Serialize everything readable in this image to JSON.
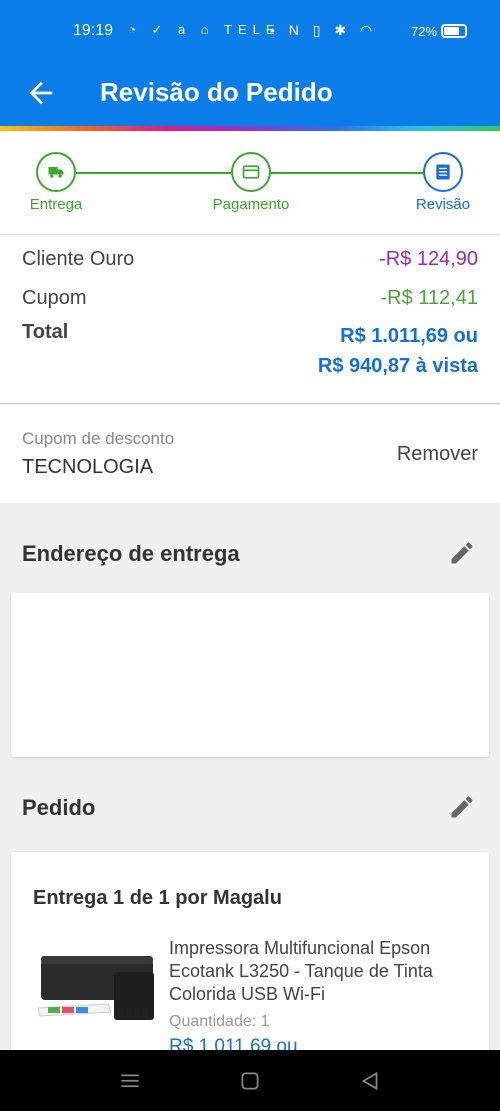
{
  "status_bar": {
    "time": "19:19",
    "left_icons_text": "◔ ✓ a ⌂ TELE",
    "right_icons_text": "• N ▯ ✱ ◠",
    "battery": "72%"
  },
  "app_bar": {
    "title": "Revisão do Pedido",
    "back_icon": "arrow-left-icon"
  },
  "stepper": {
    "steps": [
      {
        "label": "Entrega",
        "icon": "truck-icon",
        "state": "done"
      },
      {
        "label": "Pagamento",
        "icon": "card-icon",
        "state": "done"
      },
      {
        "label": "Revisão",
        "icon": "list-icon",
        "state": "active"
      }
    ]
  },
  "summary": {
    "gold_label": "Cliente Ouro",
    "gold_value": "-R$ 124,90",
    "coupon_label": "Cupom",
    "coupon_value": "-R$ 112,41",
    "total_label": "Total",
    "total_line1": "R$ 1.011,69 ou",
    "total_line2": "R$ 940,87 à vista"
  },
  "coupon": {
    "label": "Cupom de desconto",
    "code": "TECNOLOGIA",
    "remove": "Remover"
  },
  "address": {
    "title": "Endereço de entrega",
    "edit_icon": "pencil-icon"
  },
  "order": {
    "title": "Pedido",
    "edit_icon": "pencil-icon",
    "shipment": "Entrega 1 de 1 por Magalu",
    "product_name": "Impressora Multifuncional Epson Ecotank L3250 - Tanque de Tinta Colorida USB Wi-Fi",
    "quantity": "Quantidade:  1",
    "price": "R$ 1.011,69 ou"
  },
  "colors": {
    "primary": "#0a7de8",
    "success": "#3aa82a",
    "discount_purple": "#9b2c9f",
    "price_blue": "#1470d6"
  }
}
